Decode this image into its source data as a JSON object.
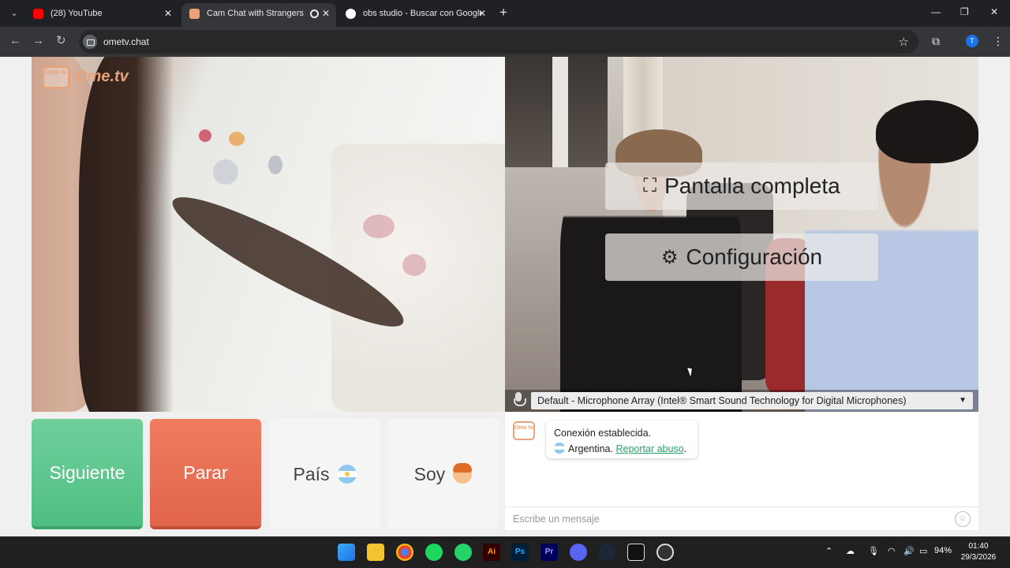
{
  "browser": {
    "tabs": [
      {
        "title": "(28) YouTube",
        "favicon_color": "#ff0000"
      },
      {
        "title": "Cam Chat with Strangers on",
        "favicon_color": "#e7a37b"
      },
      {
        "title": "obs studio - Buscar con Google",
        "favicon_color": "#4285f4"
      }
    ],
    "url": "ometv.chat",
    "profile_initial": "T"
  },
  "logo": {
    "box": "Ome tv",
    "text": "Ome.tv"
  },
  "overlay": {
    "fullscreen_label": "Pantalla completa",
    "settings_label": "Configuración"
  },
  "mic": {
    "selected": "Default - Microphone Array (Intel® Smart Sound Technology for Digital Microphones)"
  },
  "buttons": {
    "next": "Siguiente",
    "stop": "Parar",
    "country": "País",
    "gender": "Soy"
  },
  "chat": {
    "logo": "Ome tv",
    "status": "Conexión establecida.",
    "country": "Argentina.",
    "report": "Reportar abuso",
    "report_suffix": ".",
    "placeholder": "Escribe un mensaje"
  },
  "taskbar": {
    "battery": "94%",
    "time": "01:40",
    "date": "29/3/2026"
  },
  "colors": {
    "next_button": "#5bc48d",
    "stop_button": "#e8704f",
    "accent_link": "#2aa16a",
    "logo": "#e7a37b"
  }
}
